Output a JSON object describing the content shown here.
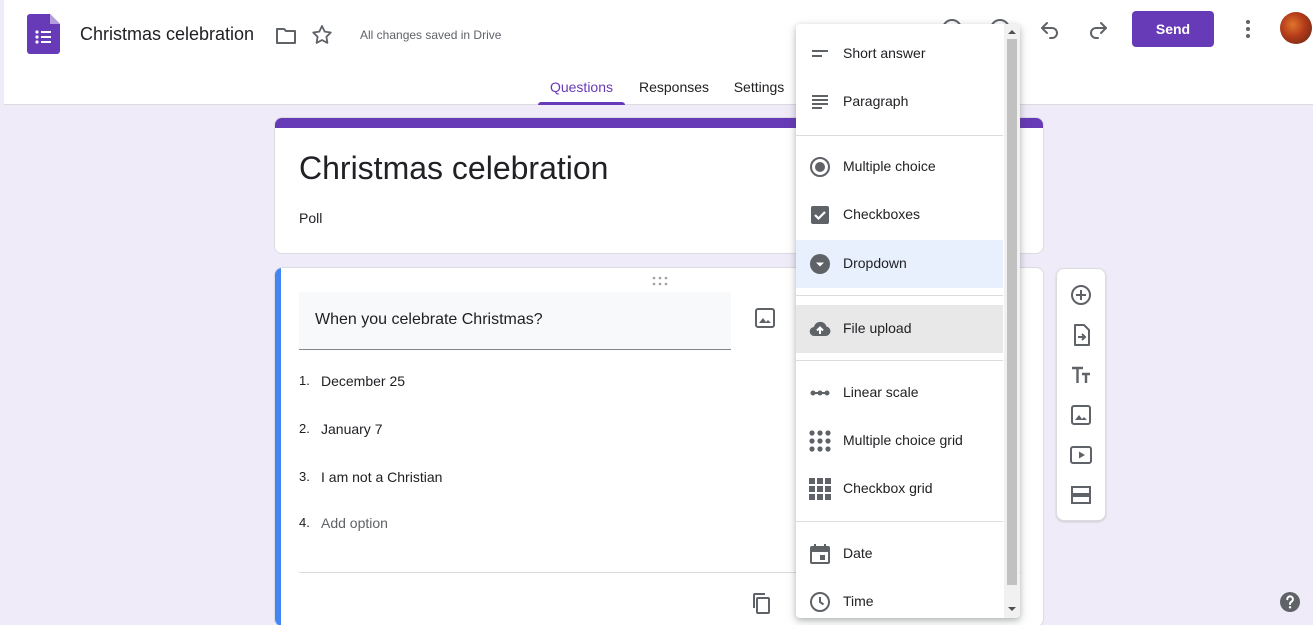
{
  "header": {
    "doc_title": "Christmas celebration",
    "save_status": "All changes saved in Drive",
    "send_label": "Send",
    "tabs": [
      {
        "label": "Questions"
      },
      {
        "label": "Responses"
      },
      {
        "label": "Settings"
      }
    ]
  },
  "form": {
    "title": "Christmas celebration",
    "description": "Poll"
  },
  "question": {
    "title": "When you celebrate Christmas?",
    "options": [
      {
        "num": "1.",
        "text": "December 25"
      },
      {
        "num": "2.",
        "text": "January 7"
      },
      {
        "num": "3.",
        "text": "I am not a Christian"
      },
      {
        "num": "4.",
        "text": "Add option"
      }
    ]
  },
  "menu": {
    "items": [
      {
        "label": "Short answer",
        "icon": "short-answer-icon"
      },
      {
        "label": "Paragraph",
        "icon": "paragraph-icon"
      },
      {
        "label": "Multiple choice",
        "icon": "radio-icon"
      },
      {
        "label": "Checkboxes",
        "icon": "checkbox-icon"
      },
      {
        "label": "Dropdown",
        "icon": "dropdown-icon"
      },
      {
        "label": "File upload",
        "icon": "cloud-upload-icon"
      },
      {
        "label": "Linear scale",
        "icon": "linear-scale-icon"
      },
      {
        "label": "Multiple choice grid",
        "icon": "dot-grid-icon"
      },
      {
        "label": "Checkbox grid",
        "icon": "checkbox-grid-icon"
      },
      {
        "label": "Date",
        "icon": "calendar-icon"
      },
      {
        "label": "Time",
        "icon": "clock-icon"
      }
    ],
    "selected": "Dropdown",
    "hovered": "File upload"
  },
  "colors": {
    "accent": "#673ab7",
    "background": "#f0ebf8",
    "active_border": "#4285f4",
    "selected_item": "#e8f0fe"
  }
}
